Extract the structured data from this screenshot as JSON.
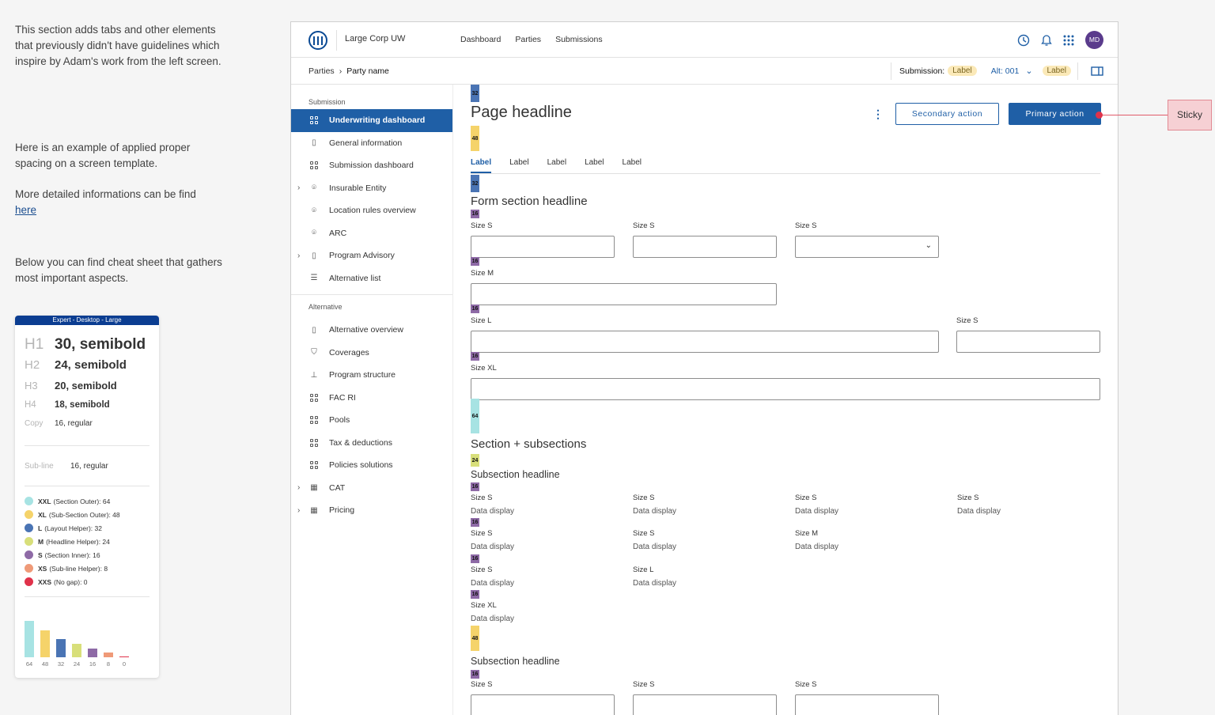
{
  "notes": {
    "p1": "This section adds tabs and other elements that previously didn't have guidelines which inspire by Adam's work from the left screen.",
    "p2": "Here is an example of applied proper spacing on a screen template.",
    "p3": "More detailed informations can be find",
    "p3_link": "here",
    "p4": "Below you can find cheat sheet that gathers most important aspects."
  },
  "cheat": {
    "header": "Expert - Desktop - Large",
    "headings": [
      {
        "k": "H1",
        "v": "30, semibold"
      },
      {
        "k": "H2",
        "v": "24, semibold"
      },
      {
        "k": "H3",
        "v": "20, semibold"
      },
      {
        "k": "H4",
        "v": "18, semibold"
      },
      {
        "k": "Copy",
        "v": "16, regular"
      }
    ],
    "subline": {
      "k": "Sub-line",
      "v": "16, regular"
    },
    "legend": [
      {
        "b": "XXL",
        "t": "(Section Outer): 64",
        "color": "#a7e3e3"
      },
      {
        "b": "XL",
        "t": "(Sub-Section Outer): 48",
        "color": "#f5d36a"
      },
      {
        "b": "L",
        "t": "(Layout Helper): 32",
        "color": "#4a74b4"
      },
      {
        "b": "M",
        "t": "(Headline Helper): 24",
        "color": "#d8df7a"
      },
      {
        "b": "S",
        "t": "(Section Inner): 16",
        "color": "#8e6aa6"
      },
      {
        "b": "XS",
        "t": "(Sub-line Helper): 8",
        "color": "#ef9a78"
      },
      {
        "b": "XXS",
        "t": "(No gap): 0",
        "color": "#e0324a"
      }
    ],
    "bar_values": [
      64,
      48,
      32,
      24,
      16,
      8,
      0
    ],
    "bar_labels": [
      "64",
      "48",
      "32",
      "24",
      "16",
      "8",
      "0"
    ]
  },
  "app": {
    "name": "Large Corp UW",
    "nav": [
      "Dashboard",
      "Parties",
      "Submissions"
    ],
    "avatar": "MD",
    "crumbs": [
      "Parties",
      "Party name"
    ],
    "submission_label": "Submission:",
    "submission_pill": "Label",
    "alt_label": "Alt: 001",
    "alt_pill": "Label"
  },
  "sidebar": {
    "group1": "Submission",
    "items1": [
      {
        "label": "Underwriting dashboard",
        "icon": "grid-icon"
      },
      {
        "label": "General information",
        "icon": "document-icon"
      },
      {
        "label": "Submission dashboard",
        "icon": "grid-icon"
      },
      {
        "label": "Insurable Entity",
        "icon": "location-pin-icon"
      },
      {
        "label": "Location rules overview",
        "icon": "location-pin-icon"
      },
      {
        "label": "ARC",
        "icon": "location-pin-icon"
      },
      {
        "label": "Program Advisory",
        "icon": "document-search-icon"
      },
      {
        "label": "Alternative list",
        "icon": "list-icon"
      }
    ],
    "group2": "Alternative",
    "items2": [
      {
        "label": "Alternative overview",
        "icon": "document-icon"
      },
      {
        "label": "Coverages",
        "icon": "shield-icon"
      },
      {
        "label": "Program structure",
        "icon": "hierarchy-icon"
      },
      {
        "label": "FAC RI",
        "icon": "grid-icon"
      },
      {
        "label": "Pools",
        "icon": "grid-icon"
      },
      {
        "label": "Tax & deductions",
        "icon": "grid-icon"
      },
      {
        "label": "Policies solutions",
        "icon": "grid-icon"
      },
      {
        "label": "CAT",
        "icon": "calculator-icon"
      },
      {
        "label": "Pricing",
        "icon": "calculator-icon"
      }
    ]
  },
  "main": {
    "headline": "Page headline",
    "secondary": "Secondary action",
    "primary": "Primary action",
    "tabs": [
      "Label",
      "Label",
      "Label",
      "Label",
      "Label"
    ],
    "form_headline": "Form section headline",
    "size_s": "Size S",
    "size_m": "Size M",
    "size_l": "Size L",
    "size_xl": "Size XL",
    "section_headline": "Section + subsections",
    "subsection_headline": "Subsection headline",
    "data_display": "Data display",
    "spacers": [
      "32",
      "48",
      "32",
      "16",
      "16",
      "16",
      "16",
      "64",
      "24",
      "16",
      "16",
      "16",
      "16",
      "48",
      "16"
    ]
  },
  "sticky": "Sticky"
}
